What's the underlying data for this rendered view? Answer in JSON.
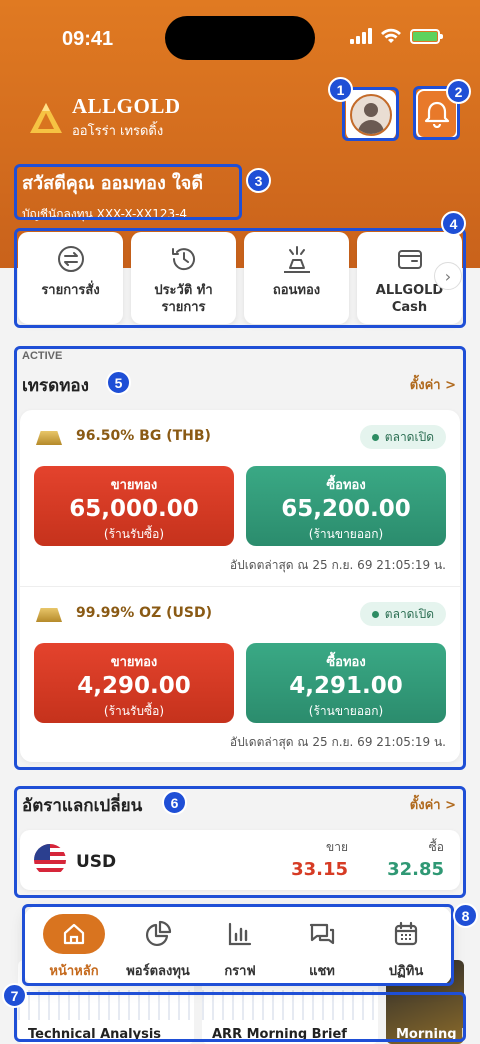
{
  "status_bar": {
    "time": "09:41"
  },
  "brand": {
    "name": "ALLGOLD",
    "tagline": "ออโรร่า เทรดดิ้ง"
  },
  "greeting": {
    "title": "สวัสดีคุณ ออมทอง ใจดี",
    "account": "บัญชีนักลงทุน XXX-X-XX123-4"
  },
  "quick_actions": [
    {
      "label": "รายการสั่ง",
      "icon": "exchange-icon"
    },
    {
      "label": "ประวัติ ทำรายการ",
      "icon": "history-icon"
    },
    {
      "label": "ถอนทอง",
      "icon": "gold-withdraw-icon"
    },
    {
      "label": "ALLGOLD Cash",
      "icon": "wallet-icon"
    }
  ],
  "trade": {
    "tag": "ACTIVE",
    "title": "เทรดทอง",
    "settings_link": "ตั้งค่า >",
    "products": [
      {
        "name": "96.50% BG (THB)",
        "status": "ตลาดเปิด",
        "sell_label": "ขายทอง",
        "sell_price": "65,000.00",
        "sell_sub": "(ร้านรับซื้อ)",
        "buy_label": "ซื้อทอง",
        "buy_price": "65,200.00",
        "buy_sub": "(ร้านขายออก)",
        "updated": "อัปเดตล่าสุด ณ 25 ก.ย. 69 21:05:19 น."
      },
      {
        "name": "99.99% OZ (USD)",
        "status": "ตลาดเปิด",
        "sell_label": "ขายทอง",
        "sell_price": "4,290.00",
        "sell_sub": "(ร้านรับซื้อ)",
        "buy_label": "ซื้อทอง",
        "buy_price": "4,291.00",
        "buy_sub": "(ร้านขายออก)",
        "updated": "อัปเดตล่าสุด ณ 25 ก.ย. 69 21:05:19 น."
      }
    ]
  },
  "fx": {
    "title": "อัตราแลกเปลี่ยน",
    "settings_link": "ตั้งค่า >",
    "currency": "USD",
    "sell_label": "ขาย",
    "sell_value": "33.15",
    "buy_label": "ซื้อ",
    "buy_value": "32.85"
  },
  "news": [
    {
      "title": "Technical Analysis"
    },
    {
      "title": "ARR Morning Brief"
    },
    {
      "title": "Morning Ne"
    }
  ],
  "tabs": [
    {
      "label": "หน้าหลัก",
      "icon": "home-icon",
      "active": true
    },
    {
      "label": "พอร์ตลงทุน",
      "icon": "pie-chart-icon"
    },
    {
      "label": "กราฟ",
      "icon": "bar-chart-icon"
    },
    {
      "label": "แชท",
      "icon": "chat-icon"
    },
    {
      "label": "ปฏิทิน",
      "icon": "calendar-icon"
    }
  ],
  "annotations": [
    "1",
    "2",
    "3",
    "4",
    "5",
    "6",
    "7",
    "8"
  ],
  "colors": {
    "brand_orange": "#d9741f",
    "sell_red": "#d63b24",
    "buy_green": "#2f9874",
    "marker_blue": "#1f4fd6"
  }
}
